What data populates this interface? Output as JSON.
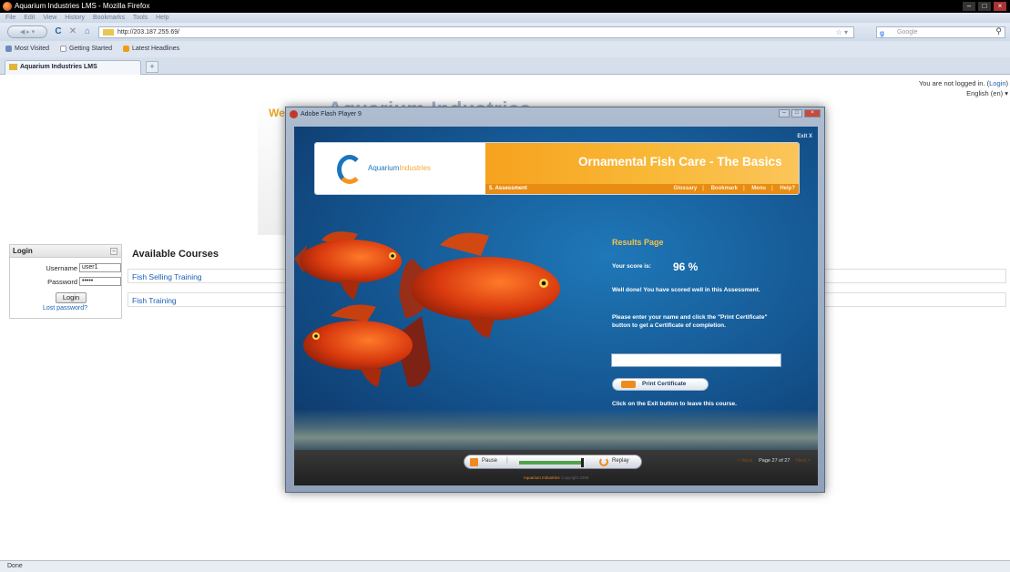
{
  "browser": {
    "window_title": "Aquarium Industries LMS - Mozilla Firefox",
    "menu": [
      "File",
      "Edit",
      "View",
      "History",
      "Bookmarks",
      "Tools",
      "Help"
    ],
    "url": "http://203.187.255.69/",
    "search_placeholder": "Google",
    "bookmarks": [
      "Most Visited",
      "Getting Started",
      "Latest Headlines"
    ],
    "tab_title": "Aquarium Industries LMS",
    "new_tab": "+",
    "status": "Done"
  },
  "page": {
    "login_status_prefix": "You are not logged in. (",
    "login_link": "Login",
    "login_status_suffix": ")",
    "language": "English (en) ▾",
    "banner_welcome": "We",
    "banner_title": "Aquarium Industries",
    "login_block": {
      "title": "Login",
      "username_label": "Username",
      "username_value": "user1",
      "password_label": "Password",
      "password_value": "•••••",
      "login_button": "Login",
      "lost_password": "Lost password?"
    },
    "courses": {
      "title": "Available Courses",
      "items": [
        "Fish Selling Training",
        "Fish Training"
      ]
    }
  },
  "flash": {
    "window_title": "Adobe Flash Player 9",
    "exit": "Exit X",
    "logo_main": "Aquarium",
    "logo_light": "Industries",
    "course_title": "Ornamental Fish Care - The Basics",
    "section": "5. Assessment",
    "nav": [
      "Glossary",
      "Bookmark",
      "Menu",
      "Help?"
    ],
    "results_title": "Results Page",
    "score_label": "Your score is:",
    "score_value": "96 %",
    "well_done": "Well done! You have scored well in this Assessment.",
    "instruction": "Please enter your name and click the \"Print Certificate\" button to get a Certificate of completion.",
    "print_button": "Print Certificate",
    "exit_note": "Click on the Exit button to leave this course.",
    "pause": "Pause",
    "replay": "Replay",
    "progress": 1.0,
    "back": "< Back",
    "page_indicator": "Page 27 of 27",
    "next": "Next >",
    "copyright_brand_a": "Aquarium",
    "copyright_brand_b": "Industries",
    "copyright_text": "Copyright 2009"
  },
  "colors": {
    "accent_orange": "#f7941d",
    "brand_blue": "#1c75bc",
    "link_blue": "#1a5fb4"
  }
}
